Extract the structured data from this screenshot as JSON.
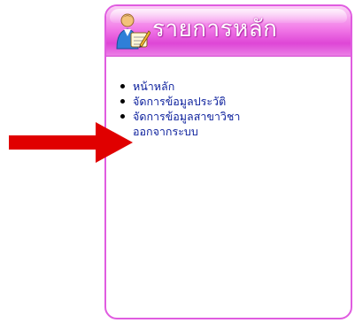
{
  "menu": {
    "title": "รายการหลัก",
    "items": [
      {
        "label": "หน้าหลัก",
        "bullet": true
      },
      {
        "label": "จัดการข้อมูลประวัติ",
        "bullet": true
      },
      {
        "label": "จัดการข้อมูลสาขาวิชา",
        "bullet": true
      },
      {
        "label": "ออกจากระบบ",
        "bullet": false
      }
    ]
  },
  "annotation": {
    "arrow_color": "#e00000",
    "points_to": "ออกจากระบบ"
  },
  "colors": {
    "header_pink": "#ee6fe4",
    "border_pink": "#e05ce0",
    "link_blue": "#0b1f9c"
  },
  "icons": {
    "header_icon": "user-edit-icon",
    "annotation_icon": "red-arrow-icon"
  }
}
